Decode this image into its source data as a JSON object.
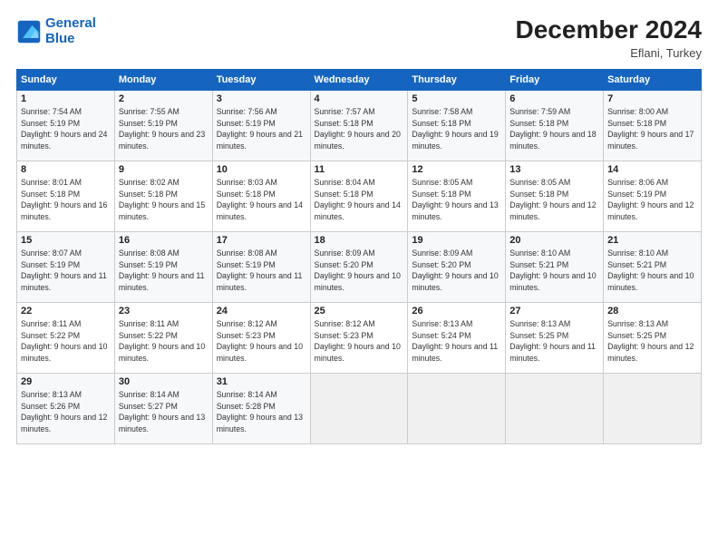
{
  "header": {
    "logo_line1": "General",
    "logo_line2": "Blue",
    "title": "December 2024",
    "subtitle": "Eflani, Turkey"
  },
  "days_of_week": [
    "Sunday",
    "Monday",
    "Tuesday",
    "Wednesday",
    "Thursday",
    "Friday",
    "Saturday"
  ],
  "weeks": [
    [
      {
        "day": "1",
        "sunrise": "7:54 AM",
        "sunset": "5:19 PM",
        "daylight": "9 hours and 24 minutes."
      },
      {
        "day": "2",
        "sunrise": "7:55 AM",
        "sunset": "5:19 PM",
        "daylight": "9 hours and 23 minutes."
      },
      {
        "day": "3",
        "sunrise": "7:56 AM",
        "sunset": "5:19 PM",
        "daylight": "9 hours and 21 minutes."
      },
      {
        "day": "4",
        "sunrise": "7:57 AM",
        "sunset": "5:18 PM",
        "daylight": "9 hours and 20 minutes."
      },
      {
        "day": "5",
        "sunrise": "7:58 AM",
        "sunset": "5:18 PM",
        "daylight": "9 hours and 19 minutes."
      },
      {
        "day": "6",
        "sunrise": "7:59 AM",
        "sunset": "5:18 PM",
        "daylight": "9 hours and 18 minutes."
      },
      {
        "day": "7",
        "sunrise": "8:00 AM",
        "sunset": "5:18 PM",
        "daylight": "9 hours and 17 minutes."
      }
    ],
    [
      {
        "day": "8",
        "sunrise": "8:01 AM",
        "sunset": "5:18 PM",
        "daylight": "9 hours and 16 minutes."
      },
      {
        "day": "9",
        "sunrise": "8:02 AM",
        "sunset": "5:18 PM",
        "daylight": "9 hours and 15 minutes."
      },
      {
        "day": "10",
        "sunrise": "8:03 AM",
        "sunset": "5:18 PM",
        "daylight": "9 hours and 14 minutes."
      },
      {
        "day": "11",
        "sunrise": "8:04 AM",
        "sunset": "5:18 PM",
        "daylight": "9 hours and 14 minutes."
      },
      {
        "day": "12",
        "sunrise": "8:05 AM",
        "sunset": "5:18 PM",
        "daylight": "9 hours and 13 minutes."
      },
      {
        "day": "13",
        "sunrise": "8:05 AM",
        "sunset": "5:18 PM",
        "daylight": "9 hours and 12 minutes."
      },
      {
        "day": "14",
        "sunrise": "8:06 AM",
        "sunset": "5:19 PM",
        "daylight": "9 hours and 12 minutes."
      }
    ],
    [
      {
        "day": "15",
        "sunrise": "8:07 AM",
        "sunset": "5:19 PM",
        "daylight": "9 hours and 11 minutes."
      },
      {
        "day": "16",
        "sunrise": "8:08 AM",
        "sunset": "5:19 PM",
        "daylight": "9 hours and 11 minutes."
      },
      {
        "day": "17",
        "sunrise": "8:08 AM",
        "sunset": "5:19 PM",
        "daylight": "9 hours and 11 minutes."
      },
      {
        "day": "18",
        "sunrise": "8:09 AM",
        "sunset": "5:20 PM",
        "daylight": "9 hours and 10 minutes."
      },
      {
        "day": "19",
        "sunrise": "8:09 AM",
        "sunset": "5:20 PM",
        "daylight": "9 hours and 10 minutes."
      },
      {
        "day": "20",
        "sunrise": "8:10 AM",
        "sunset": "5:21 PM",
        "daylight": "9 hours and 10 minutes."
      },
      {
        "day": "21",
        "sunrise": "8:10 AM",
        "sunset": "5:21 PM",
        "daylight": "9 hours and 10 minutes."
      }
    ],
    [
      {
        "day": "22",
        "sunrise": "8:11 AM",
        "sunset": "5:22 PM",
        "daylight": "9 hours and 10 minutes."
      },
      {
        "day": "23",
        "sunrise": "8:11 AM",
        "sunset": "5:22 PM",
        "daylight": "9 hours and 10 minutes."
      },
      {
        "day": "24",
        "sunrise": "8:12 AM",
        "sunset": "5:23 PM",
        "daylight": "9 hours and 10 minutes."
      },
      {
        "day": "25",
        "sunrise": "8:12 AM",
        "sunset": "5:23 PM",
        "daylight": "9 hours and 10 minutes."
      },
      {
        "day": "26",
        "sunrise": "8:13 AM",
        "sunset": "5:24 PM",
        "daylight": "9 hours and 11 minutes."
      },
      {
        "day": "27",
        "sunrise": "8:13 AM",
        "sunset": "5:25 PM",
        "daylight": "9 hours and 11 minutes."
      },
      {
        "day": "28",
        "sunrise": "8:13 AM",
        "sunset": "5:25 PM",
        "daylight": "9 hours and 12 minutes."
      }
    ],
    [
      {
        "day": "29",
        "sunrise": "8:13 AM",
        "sunset": "5:26 PM",
        "daylight": "9 hours and 12 minutes."
      },
      {
        "day": "30",
        "sunrise": "8:14 AM",
        "sunset": "5:27 PM",
        "daylight": "9 hours and 13 minutes."
      },
      {
        "day": "31",
        "sunrise": "8:14 AM",
        "sunset": "5:28 PM",
        "daylight": "9 hours and 13 minutes."
      },
      null,
      null,
      null,
      null
    ]
  ]
}
